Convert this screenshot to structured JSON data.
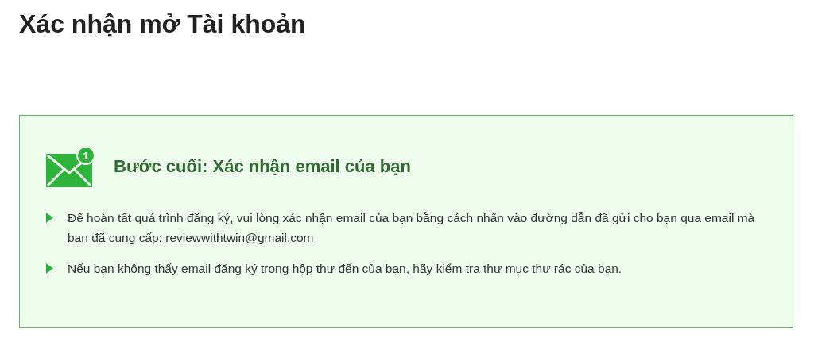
{
  "page_title": "Xác nhận mở Tài khoản",
  "notice": {
    "badge": "1",
    "heading": "Bước cuối: Xác nhận email của bạn",
    "items": [
      "Để hoàn tất quá trình đăng ký, vui lòng xác nhận email của bạn bằng cách nhấn vào đường dẫn đã gửi cho bạn qua email mà bạn đã cung cấp: reviewwithtwin@gmail.com",
      "Nếu bạn không thấy email đăng ký trong hộp thư đến của bạn, hãy kiểm tra thư mục thư rác của bạn."
    ]
  }
}
